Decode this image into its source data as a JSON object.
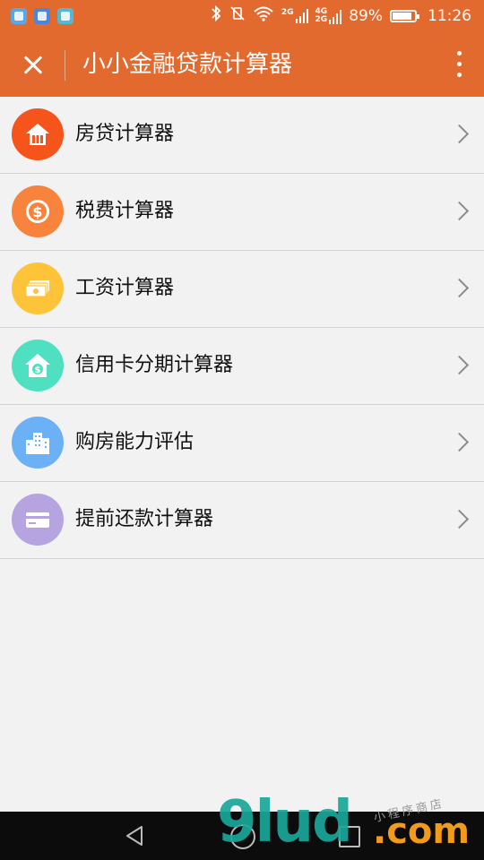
{
  "status_bar": {
    "app_icons": [
      "telegram-icon",
      "gallery-icon",
      "message-icon"
    ],
    "bluetooth": "bluetooth-icon",
    "mute": "vibrate-off-icon",
    "wifi": "wifi-icon",
    "network_1": "2G",
    "network_2_top": "4G",
    "network_2_bottom": "2G",
    "battery": "89%",
    "battery_level": 0.89,
    "time": "11:26"
  },
  "header": {
    "title": "小小金融贷款计算器",
    "close_icon": "close-icon",
    "more_icon": "more-vertical-icon",
    "background": "#e36a2e"
  },
  "menu": [
    {
      "label": "房贷计算器",
      "icon": "house-icon",
      "color": "#f5541a"
    },
    {
      "label": "税费计算器",
      "icon": "coin-icon",
      "color": "#f7833c"
    },
    {
      "label": "工资计算器",
      "icon": "cash-icon",
      "color": "#fdc43a"
    },
    {
      "label": "信用卡分期计算器",
      "icon": "house-dollar-icon",
      "color": "#4fe0c2"
    },
    {
      "label": "购房能力评估",
      "icon": "buildings-icon",
      "color": "#6cb0f5"
    },
    {
      "label": "提前还款计算器",
      "icon": "card-icon",
      "color": "#b5a4e0"
    }
  ],
  "watermark": {
    "brand": "9lud",
    "domain": ".com",
    "tagline": "小程序商店"
  }
}
